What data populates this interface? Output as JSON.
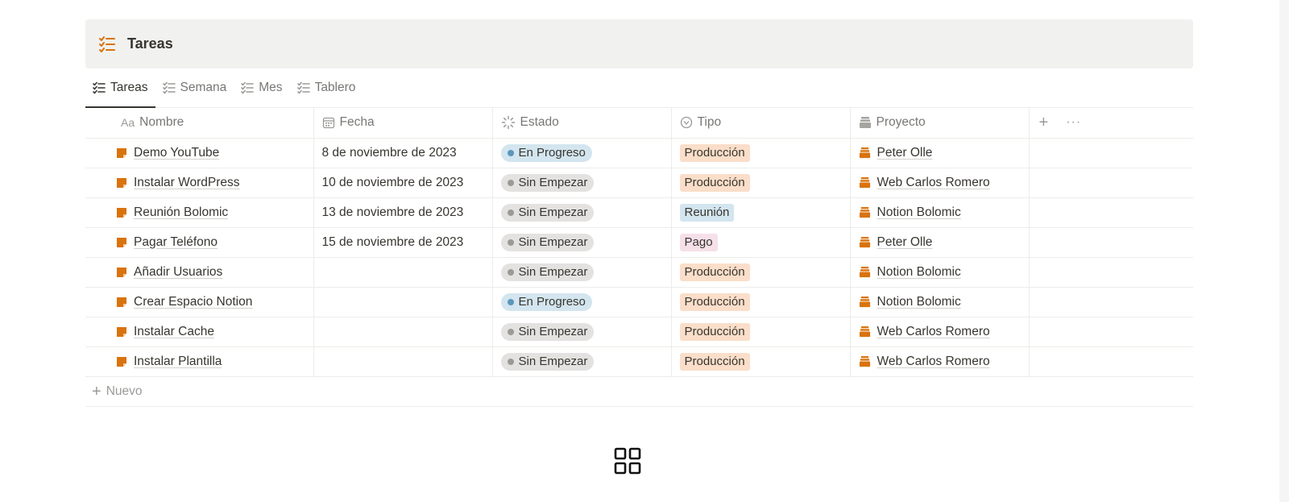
{
  "database": {
    "title": "Tareas",
    "title_icon": "checklist-icon",
    "accent_color": "#d9730d"
  },
  "tabs": [
    {
      "label": "Tareas",
      "active": true
    },
    {
      "label": "Semana",
      "active": false
    },
    {
      "label": "Mes",
      "active": false
    },
    {
      "label": "Tablero",
      "active": false
    }
  ],
  "columns": {
    "nombre": {
      "label": "Nombre",
      "icon_text": "Aa"
    },
    "fecha": {
      "label": "Fecha",
      "icon": "calendar-icon"
    },
    "estado": {
      "label": "Estado",
      "icon": "status-icon"
    },
    "tipo": {
      "label": "Tipo",
      "icon": "select-icon"
    },
    "proyecto": {
      "label": "Proyecto",
      "icon": "relation-icon"
    }
  },
  "status_colors": {
    "En Progreso": {
      "bg": "#d3e5ef",
      "dot": "#5b97bd"
    },
    "Sin Empezar": {
      "bg": "#e3e2e0",
      "dot": "#9b9a97"
    }
  },
  "tag_colors": {
    "Producción": "#fadec9",
    "Reunión": "#d3e5ef",
    "Pago": "#f5e0e9"
  },
  "rows": [
    {
      "nombre": "Demo YouTube",
      "fecha": "8 de noviembre de 2023",
      "estado": "En Progreso",
      "tipo": "Producción",
      "proyecto": "Peter Olle"
    },
    {
      "nombre": "Instalar WordPress",
      "fecha": "10 de noviembre de 2023",
      "estado": "Sin Empezar",
      "tipo": "Producción",
      "proyecto": "Web Carlos Romero"
    },
    {
      "nombre": "Reunión Bolomic",
      "fecha": "13 de noviembre de 2023",
      "estado": "Sin Empezar",
      "tipo": "Reunión",
      "proyecto": "Notion Bolomic"
    },
    {
      "nombre": "Pagar Teléfono",
      "fecha": "15 de noviembre de 2023",
      "estado": "Sin Empezar",
      "tipo": "Pago",
      "proyecto": "Peter Olle"
    },
    {
      "nombre": "Añadir Usuarios",
      "fecha": "",
      "estado": "Sin Empezar",
      "tipo": "Producción",
      "proyecto": "Notion Bolomic"
    },
    {
      "nombre": "Crear Espacio Notion",
      "fecha": "",
      "estado": "En Progreso",
      "tipo": "Producción",
      "proyecto": "Notion Bolomic"
    },
    {
      "nombre": "Instalar Cache",
      "fecha": "",
      "estado": "Sin Empezar",
      "tipo": "Producción",
      "proyecto": "Web Carlos Romero"
    },
    {
      "nombre": "Instalar Plantilla",
      "fecha": "",
      "estado": "Sin Empezar",
      "tipo": "Producción",
      "proyecto": "Web Carlos Romero"
    }
  ],
  "new_row_label": "Nuevo"
}
